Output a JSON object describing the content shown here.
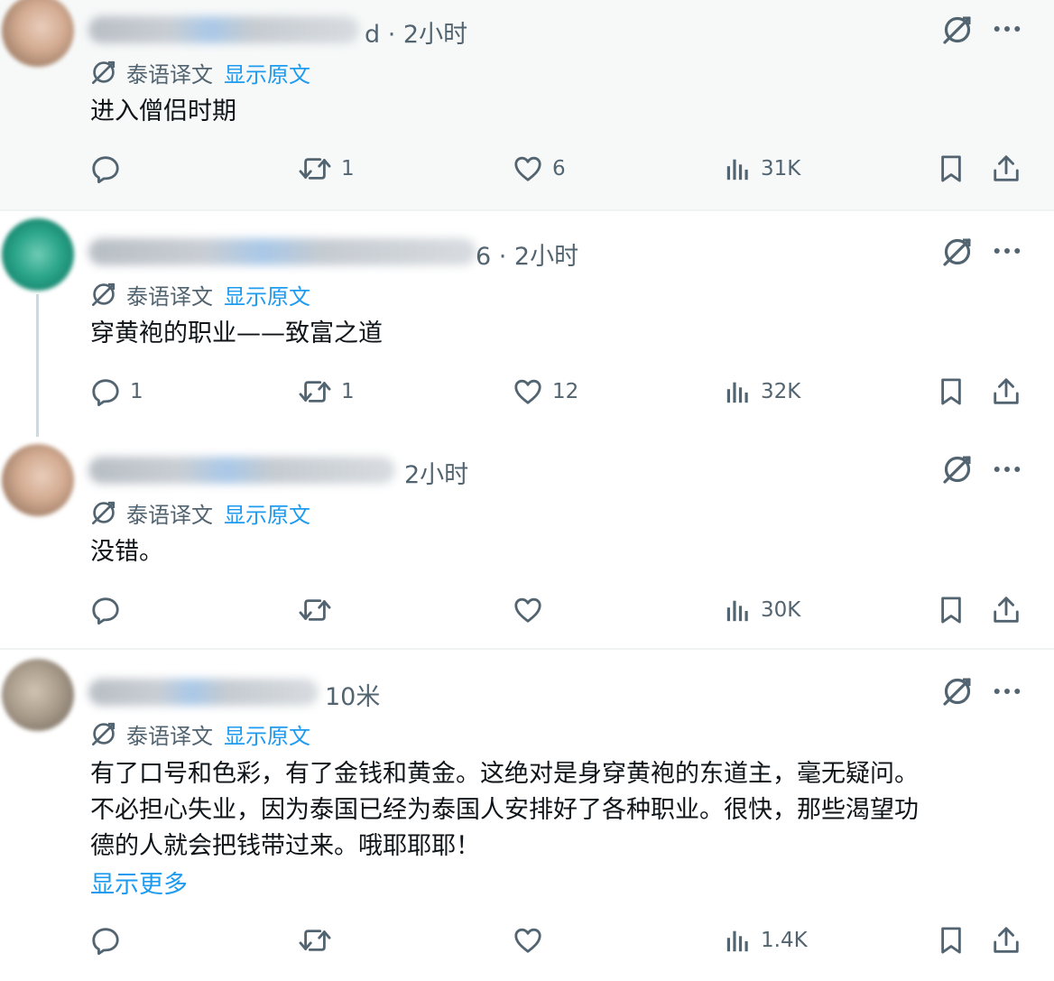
{
  "tweets": [
    {
      "meta_suffix": "d · 2小时",
      "translation_label": "泰语译文",
      "show_original": "显示原文",
      "text": "进入僧侣时期",
      "reply_count": "",
      "retweet_count": "1",
      "like_count": "6",
      "view_count": "31K"
    },
    {
      "meta_suffix": "6 · 2小时",
      "translation_label": "泰语译文",
      "show_original": "显示原文",
      "text": "穿黄袍的职业——致富之道",
      "reply_count": "1",
      "retweet_count": "1",
      "like_count": "12",
      "view_count": "32K"
    },
    {
      "meta_suffix": "2小时",
      "translation_label": "泰语译文",
      "show_original": "显示原文",
      "text": "没错。",
      "reply_count": "",
      "retweet_count": "",
      "like_count": "",
      "view_count": "30K"
    },
    {
      "meta_suffix": "10米",
      "translation_label": "泰语译文",
      "show_original": "显示原文",
      "text_lines": [
        "有了口号和色彩，有了金钱和黄金。这绝对是身穿黄袍的东道主，毫无疑问。",
        "不必担心失业，因为泰国已经为泰国人安排好了各种职业。很快，那些渴望功",
        "德的人就会把钱带过来。哦耶耶耶！"
      ],
      "show_more": "显示更多",
      "reply_count": "",
      "retweet_count": "",
      "like_count": "",
      "view_count": "1.4K"
    }
  ],
  "icons": [
    "grok-icon",
    "more-icon",
    "translate-icon",
    "reply-icon",
    "retweet-icon",
    "like-icon",
    "views-icon",
    "bookmark-icon",
    "share-icon"
  ],
  "colors": {
    "link": "#1d9bf0",
    "muted": "#536471",
    "text": "#0f1419",
    "divider": "#eff3f4",
    "highlight_bg": "#f7f9f9"
  }
}
